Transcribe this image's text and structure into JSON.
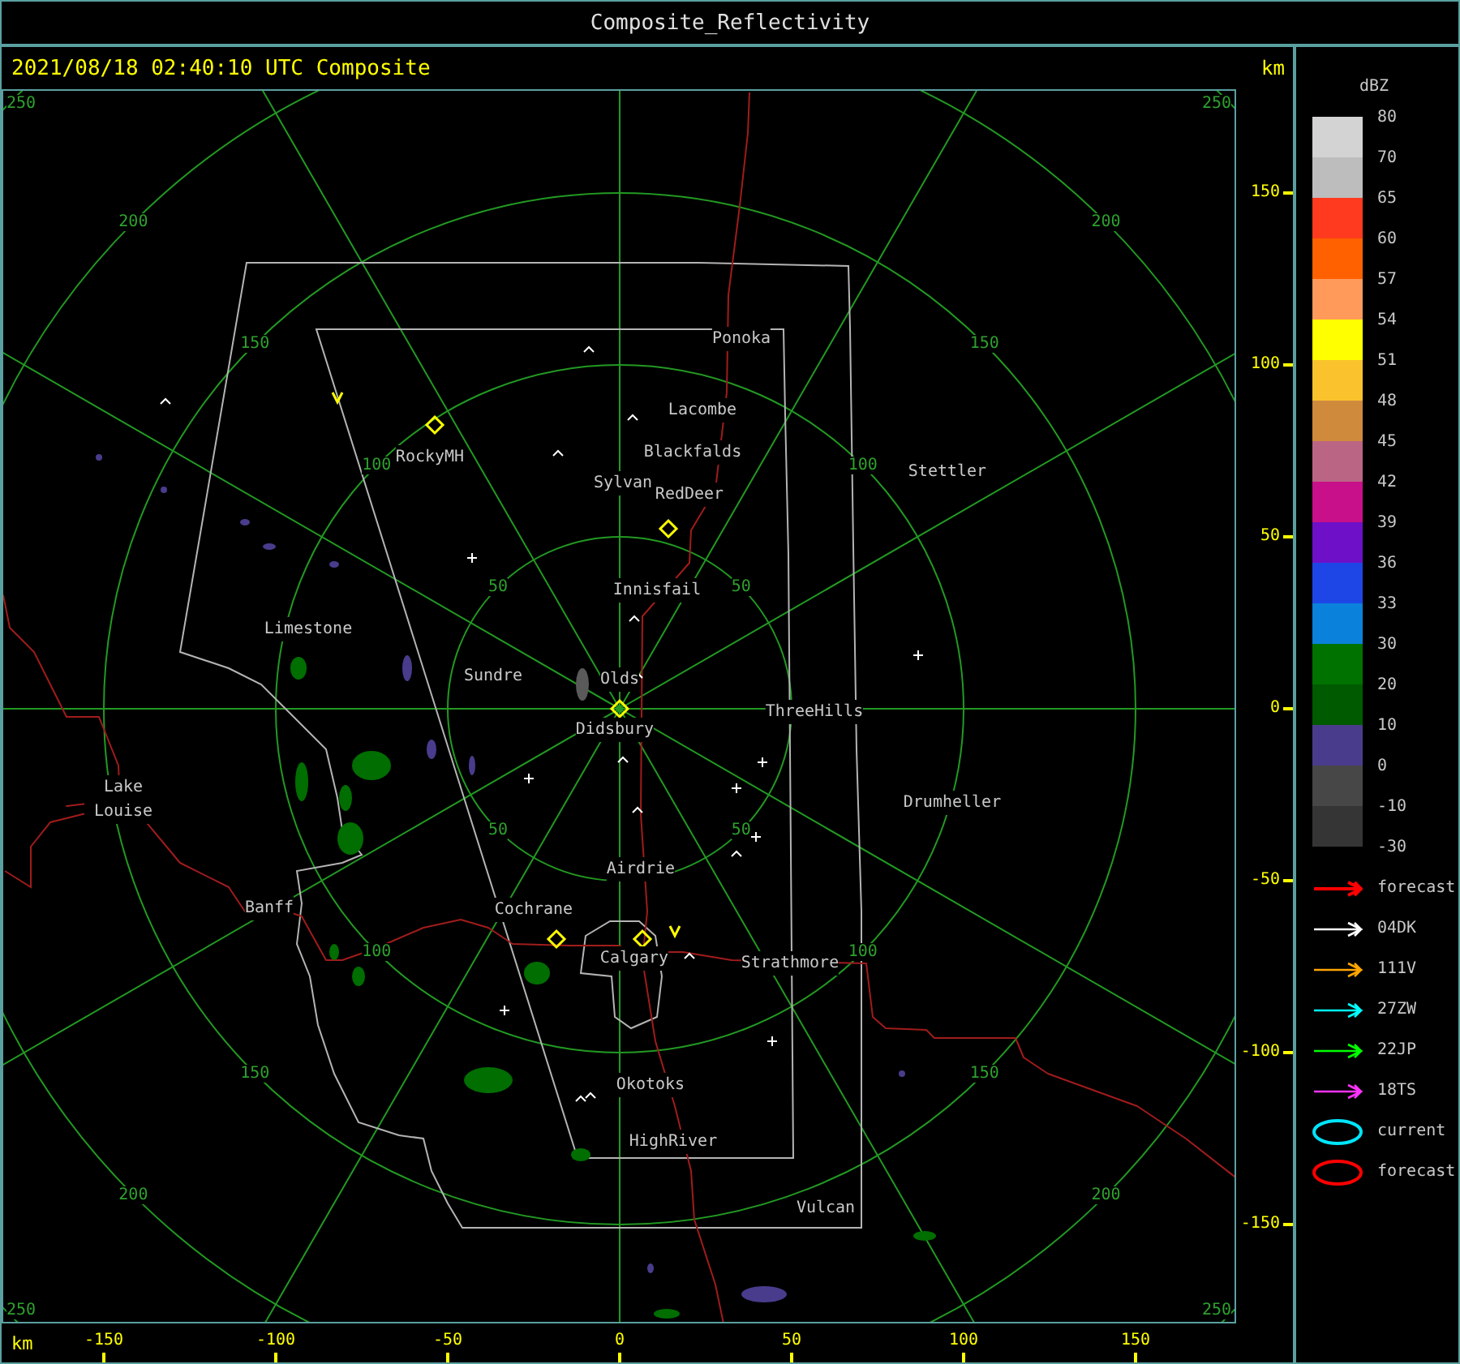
{
  "window": {
    "title": "Composite_Reflectivity"
  },
  "header": {
    "timestamp": "2021/08/18 02:40:10 UTC Composite",
    "unit": "km"
  },
  "map": {
    "range_rings": [
      {
        "labels": [
          "50",
          "50",
          "50",
          "50"
        ]
      },
      {
        "labels": [
          "100",
          "100",
          "100",
          "100"
        ]
      },
      {
        "labels": [
          "150",
          "150",
          "150",
          "150"
        ]
      },
      {
        "labels": [
          "200",
          "200",
          "200",
          "200"
        ]
      },
      {
        "labels": [
          "250",
          "250",
          "250",
          "250"
        ]
      }
    ],
    "places": [
      {
        "name": "Ponoka"
      },
      {
        "name": "Lacombe"
      },
      {
        "name": "Blackfalds"
      },
      {
        "name": "Sylvan"
      },
      {
        "name": "RedDeer"
      },
      {
        "name": "RockyMH"
      },
      {
        "name": "Stettler"
      },
      {
        "name": "Innisfail"
      },
      {
        "name": "Limestone"
      },
      {
        "name": "Sundre"
      },
      {
        "name": "Olds"
      },
      {
        "name": "ThreeHills"
      },
      {
        "name": "Didsbury"
      },
      {
        "name": "Lake Louise"
      },
      {
        "name": "Drumheller"
      },
      {
        "name": "Airdrie"
      },
      {
        "name": "Banff"
      },
      {
        "name": "Cochrane"
      },
      {
        "name": "Calgary"
      },
      {
        "name": "Strathmore"
      },
      {
        "name": "Okotoks"
      },
      {
        "name": "HighRiver"
      },
      {
        "name": "Vulcan"
      }
    ]
  },
  "y_axis": {
    "ticks": [
      "150",
      "100",
      "50",
      "0",
      "-50",
      "-100",
      "-150"
    ]
  },
  "x_axis": {
    "unit": "km",
    "ticks": [
      "-150",
      "-100",
      "-50",
      "0",
      "50",
      "100",
      "150"
    ]
  },
  "legend": {
    "title": "dBZ",
    "bands": [
      {
        "color": "#d3d3d3"
      },
      {
        "color": "#bdbdbd"
      },
      {
        "color": "#ff3a1e"
      },
      {
        "color": "#ff6000"
      },
      {
        "color": "#ff9a5a"
      },
      {
        "color": "#ffff00"
      },
      {
        "color": "#fac32d"
      },
      {
        "color": "#d08a3c"
      },
      {
        "color": "#bb6585"
      },
      {
        "color": "#c8108a"
      },
      {
        "color": "#6e10c8"
      },
      {
        "color": "#1e46e6"
      },
      {
        "color": "#0a82dc"
      },
      {
        "color": "#007200"
      },
      {
        "color": "#005a00"
      },
      {
        "color": "#4a3c8c"
      },
      {
        "color": "#474747"
      },
      {
        "color": "#353535"
      }
    ],
    "labels": [
      "80",
      "70",
      "65",
      "60",
      "57",
      "54",
      "51",
      "48",
      "45",
      "42",
      "39",
      "36",
      "33",
      "30",
      "20",
      "10",
      "0",
      "-10",
      "-30"
    ],
    "tracks": [
      {
        "kind": "arrow",
        "color": "#ff0000",
        "label": "forecast"
      },
      {
        "kind": "arrow",
        "color": "#ffffff",
        "label": "04DK"
      },
      {
        "kind": "arrow",
        "color": "#ffa500",
        "label": "111V"
      },
      {
        "kind": "arrow",
        "color": "#00ffff",
        "label": "27ZW"
      },
      {
        "kind": "arrow",
        "color": "#00ff00",
        "label": "22JP"
      },
      {
        "kind": "arrow",
        "color": "#ff33ff",
        "label": "18TS"
      },
      {
        "kind": "ellipse",
        "color": "#00e5ff",
        "label": "current"
      },
      {
        "kind": "ellipse",
        "color": "#ff0000",
        "label": "forecast"
      }
    ]
  }
}
